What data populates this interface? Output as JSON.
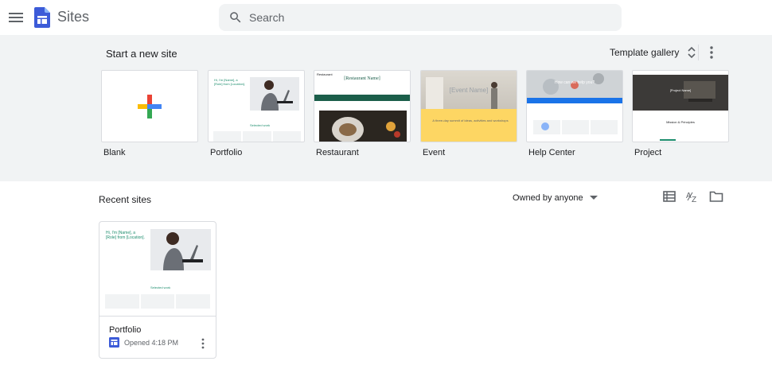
{
  "header": {
    "app_title": "Sites",
    "search_placeholder": "Search"
  },
  "templates": {
    "section_title": "Start a new site",
    "gallery_label": "Template gallery",
    "items": [
      {
        "label": "Blank"
      },
      {
        "label": "Portfolio",
        "preview_heading": "Hi, I'm [Name], a [Role] from [Location].",
        "preview_link": "Selected work"
      },
      {
        "label": "Restaurant",
        "preview_heading": "[Restaurant Name]",
        "preview_brand": "Restaurant"
      },
      {
        "label": "Event",
        "preview_heading": "[Event Name]",
        "preview_caption": "A three-day summit of ideas, activities and workshops"
      },
      {
        "label": "Help Center",
        "preview_heading": "How can we help you?"
      },
      {
        "label": "Project",
        "preview_heading": "[Project Name]",
        "preview_caption": "Mission & Principles"
      }
    ]
  },
  "recent": {
    "section_title": "Recent sites",
    "owner_filter": "Owned by anyone",
    "sites": [
      {
        "name": "Portfolio",
        "opened": "Opened 4:18 PM",
        "preview_heading": "Hi, I'm [Name], a [Role] from [Location].",
        "preview_link": "Selected work"
      }
    ]
  },
  "colors": {
    "brand_blue": "#4285f4",
    "sites_icon": "#3c5bd8",
    "band_bg": "#f1f3f4",
    "event_yellow": "#fdd663",
    "help_blue": "#1a73e8",
    "restaurant_green": "#1b5e4a"
  }
}
